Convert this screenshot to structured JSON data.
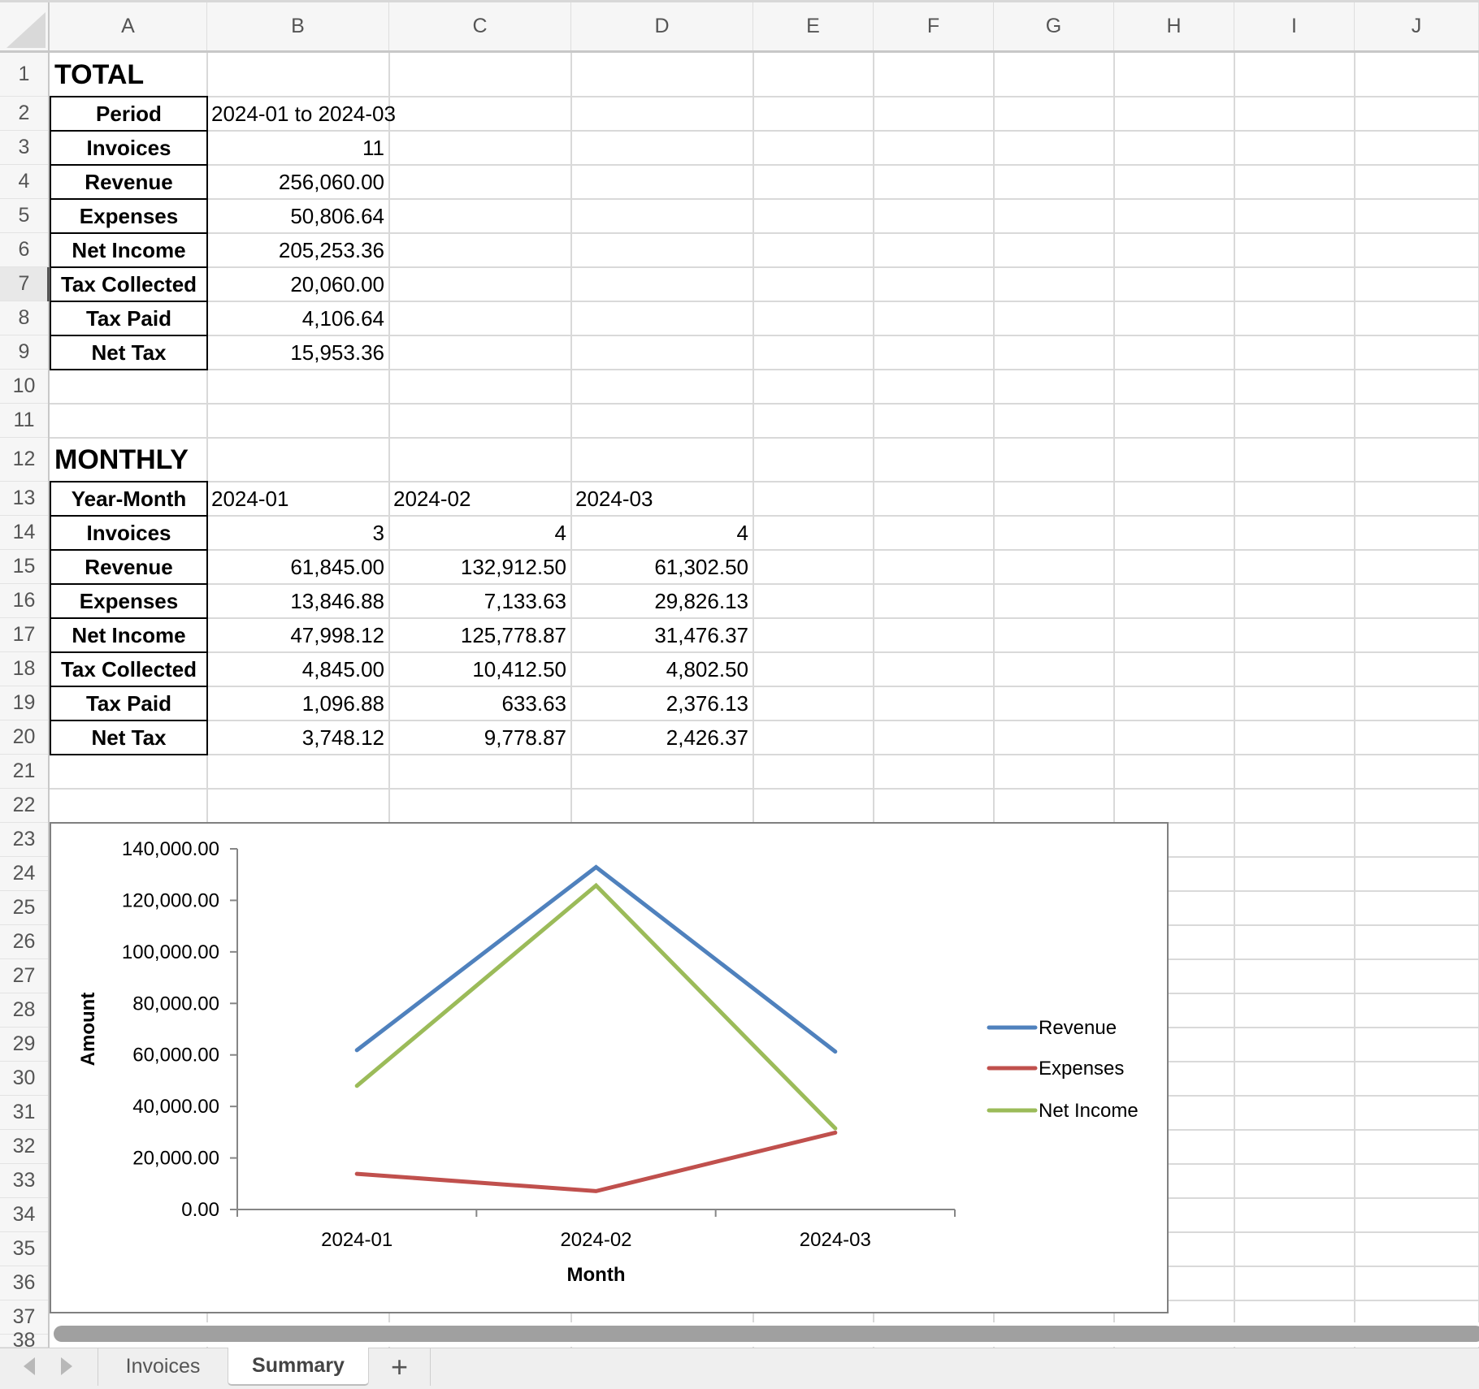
{
  "columns": [
    "A",
    "B",
    "C",
    "D",
    "E",
    "F",
    "G",
    "H",
    "I",
    "J"
  ],
  "rows": [
    "1",
    "2",
    "3",
    "4",
    "5",
    "6",
    "7",
    "8",
    "9",
    "10",
    "11",
    "12",
    "13",
    "14",
    "15",
    "16",
    "17",
    "18",
    "19",
    "20",
    "21",
    "22",
    "23",
    "24",
    "25",
    "26",
    "27",
    "28",
    "29",
    "30",
    "31",
    "32",
    "33",
    "34",
    "35",
    "36",
    "37",
    "38"
  ],
  "selected_row": "7",
  "total": {
    "title": "TOTAL",
    "labels": [
      "Period",
      "Invoices",
      "Revenue",
      "Expenses",
      "Net Income",
      "Tax Collected",
      "Tax Paid",
      "Net Tax"
    ],
    "values": [
      "2024-01 to 2024-03",
      "11",
      "256,060.00",
      "50,806.64",
      "205,253.36",
      "20,060.00",
      "4,106.64",
      "15,953.36"
    ]
  },
  "monthly": {
    "title": "MONTHLY",
    "labels": [
      "Year-Month",
      "Invoices",
      "Revenue",
      "Expenses",
      "Net Income",
      "Tax Collected",
      "Tax Paid",
      "Net Tax"
    ],
    "months": [
      "2024-01",
      "2024-02",
      "2024-03"
    ],
    "values": [
      [
        "3",
        "4",
        "4"
      ],
      [
        "61,845.00",
        "132,912.50",
        "61,302.50"
      ],
      [
        "13,846.88",
        "7,133.63",
        "29,826.13"
      ],
      [
        "47,998.12",
        "125,778.87",
        "31,476.37"
      ],
      [
        "4,845.00",
        "10,412.50",
        "4,802.50"
      ],
      [
        "1,096.88",
        "633.63",
        "2,376.13"
      ],
      [
        "3,748.12",
        "9,778.87",
        "2,426.37"
      ]
    ]
  },
  "chart_data": {
    "type": "line",
    "title": "",
    "xlabel": "Month",
    "ylabel": "Amount",
    "categories": [
      "2024-01",
      "2024-02",
      "2024-03"
    ],
    "ylim": [
      0,
      140000
    ],
    "yticks": [
      0,
      20000,
      40000,
      60000,
      80000,
      100000,
      120000,
      140000
    ],
    "ytick_labels": [
      "0.00",
      "20,000.00",
      "40,000.00",
      "60,000.00",
      "80,000.00",
      "100,000.00",
      "120,000.00",
      "140,000.00"
    ],
    "grid": false,
    "legend": "right",
    "series": [
      {
        "name": "Revenue",
        "color": "#4F81BD",
        "values": [
          61845.0,
          132912.5,
          61302.5
        ]
      },
      {
        "name": "Expenses",
        "color": "#C0504D",
        "values": [
          13846.88,
          7133.63,
          29826.13
        ]
      },
      {
        "name": "Net Income",
        "color": "#9BBB59",
        "values": [
          47998.12,
          125778.87,
          31476.37
        ]
      }
    ]
  },
  "sheet_tabs": {
    "tabs": [
      "Invoices",
      "Summary"
    ],
    "active": "Summary",
    "add_label": "+"
  }
}
